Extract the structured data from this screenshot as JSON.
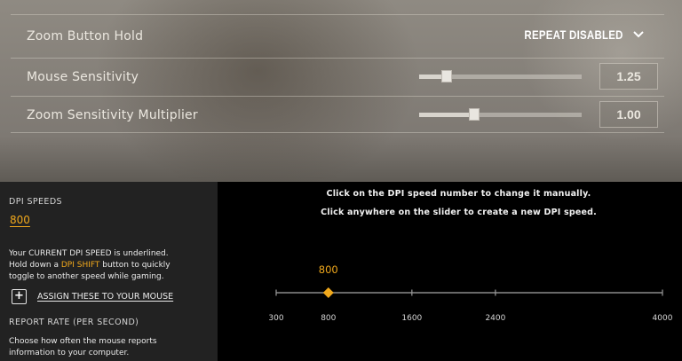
{
  "settings": {
    "zoom_button_hold": {
      "label": "Zoom Button Hold",
      "value": "REPEAT DISABLED"
    },
    "mouse_sensitivity": {
      "label": "Mouse Sensitivity",
      "value": "1.25",
      "level": 0.17
    },
    "zoom_sensitivity_multiplier": {
      "label": "Zoom Sensitivity Multiplier",
      "value": "1.00",
      "level": 0.34
    }
  },
  "dpi": {
    "heading": "DPI SPEEDS",
    "current": "800",
    "help_1": "Your CURRENT DPI SPEED is underlined.",
    "help_2a": "Hold down a ",
    "help_2b": "DPI SHIFT",
    "help_2c": " button to quickly",
    "help_3": "toggle to another speed while gaming.",
    "assign_label": "ASSIGN THESE TO YOUR MOUSE",
    "instruction_1": "Click on the DPI speed number to change it manually.",
    "instruction_2": "Click anywhere on the slider to create a new DPI speed.",
    "slider": {
      "min": 300,
      "max": 4000,
      "ticks": [
        300,
        800,
        1600,
        2400,
        4000
      ],
      "speeds": [
        800
      ],
      "speed_label": "800"
    }
  },
  "report_rate": {
    "heading": "REPORT RATE (PER SECOND)",
    "help_1": "Choose how often the mouse reports",
    "help_2": "information to your computer."
  },
  "colors": {
    "accent": "#f0a81c"
  }
}
